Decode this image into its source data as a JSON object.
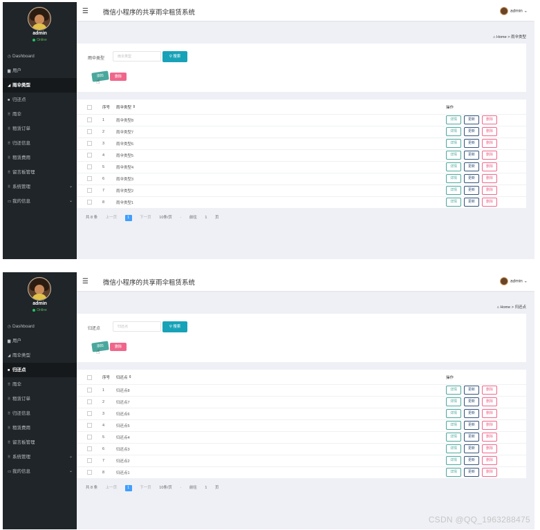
{
  "panels": [
    {
      "app_title": "微信小程序的共享雨伞租赁系统",
      "user": {
        "name": "admin",
        "status": "Online"
      },
      "menu": [
        {
          "label": "Dashboard",
          "icon": "clock-icon",
          "active": false
        },
        {
          "label": "用户",
          "icon": "folder-icon",
          "active": false
        },
        {
          "label": "雨伞类型",
          "icon": "arrow-icon",
          "active": true
        },
        {
          "label": "归还点",
          "icon": "square-icon",
          "active": false
        },
        {
          "label": "雨伞",
          "icon": "grid-icon",
          "active": false
        },
        {
          "label": "租赁订单",
          "icon": "grid-icon",
          "active": false
        },
        {
          "label": "归还信息",
          "icon": "grid-icon",
          "active": false
        },
        {
          "label": "租赁费用",
          "icon": "grid-icon",
          "active": false
        },
        {
          "label": "留言板管理",
          "icon": "grid-icon",
          "active": false
        },
        {
          "label": "系统管理",
          "icon": "grid-icon",
          "active": false,
          "has_chevron": true
        },
        {
          "label": "我的信息",
          "icon": "monitor-icon",
          "active": false,
          "has_chevron": true
        }
      ],
      "admin_label": "admin",
      "breadcrumb": {
        "home": "Home",
        "sep": ">",
        "current": "雨伞类型"
      },
      "search": {
        "label": "雨伞类型",
        "placeholder": "雨伞类型",
        "button": "搜索"
      },
      "actions": {
        "add": "添加",
        "delete": "删除"
      },
      "table": {
        "headers": {
          "index": "序号",
          "name": "雨伞类型",
          "sort": "⇕",
          "ops": "操作"
        },
        "rows": [
          {
            "index": "1",
            "name": "雨伞类型8"
          },
          {
            "index": "2",
            "name": "雨伞类型7"
          },
          {
            "index": "3",
            "name": "雨伞类型6"
          },
          {
            "index": "4",
            "name": "雨伞类型5"
          },
          {
            "index": "5",
            "name": "雨伞类型4"
          },
          {
            "index": "6",
            "name": "雨伞类型3"
          },
          {
            "index": "7",
            "name": "雨伞类型2"
          },
          {
            "index": "8",
            "name": "雨伞类型1"
          }
        ],
        "op_labels": {
          "detail": "详情",
          "edit": "更新",
          "remove": "删除"
        }
      },
      "pagination": {
        "total": "共 8 条",
        "prev": "上一页",
        "current": "1",
        "next": "下一页",
        "per_page": "10条/页",
        "dash": "-",
        "goto": "前往",
        "page_num": "1",
        "page_suffix": "页"
      }
    },
    {
      "app_title": "微信小程序的共享雨伞租赁系统",
      "user": {
        "name": "admin",
        "status": "Online"
      },
      "menu": [
        {
          "label": "Dashboard",
          "icon": "clock-icon",
          "active": false
        },
        {
          "label": "用户",
          "icon": "folder-icon",
          "active": false
        },
        {
          "label": "雨伞类型",
          "icon": "arrow-icon",
          "active": false
        },
        {
          "label": "归还点",
          "icon": "square-icon",
          "active": true
        },
        {
          "label": "雨伞",
          "icon": "grid-icon",
          "active": false
        },
        {
          "label": "租赁订单",
          "icon": "grid-icon",
          "active": false
        },
        {
          "label": "归还信息",
          "icon": "grid-icon",
          "active": false
        },
        {
          "label": "租赁费用",
          "icon": "grid-icon",
          "active": false
        },
        {
          "label": "留言板管理",
          "icon": "grid-icon",
          "active": false
        },
        {
          "label": "系统管理",
          "icon": "grid-icon",
          "active": false,
          "has_chevron": true
        },
        {
          "label": "我的信息",
          "icon": "monitor-icon",
          "active": false,
          "has_chevron": true
        }
      ],
      "admin_label": "admin",
      "breadcrumb": {
        "home": "Home",
        "sep": ">",
        "current": "归还点"
      },
      "search": {
        "label": "归还点",
        "placeholder": "归还点",
        "button": "搜索"
      },
      "actions": {
        "add": "添加",
        "delete": "删除"
      },
      "table": {
        "headers": {
          "index": "序号",
          "name": "归还点",
          "sort": "⇕",
          "ops": "操作"
        },
        "rows": [
          {
            "index": "1",
            "name": "归还点8"
          },
          {
            "index": "2",
            "name": "归还点7"
          },
          {
            "index": "3",
            "name": "归还点6"
          },
          {
            "index": "4",
            "name": "归还点5"
          },
          {
            "index": "5",
            "name": "归还点4"
          },
          {
            "index": "6",
            "name": "归还点3"
          },
          {
            "index": "7",
            "name": "归还点2"
          },
          {
            "index": "8",
            "name": "归还点1"
          }
        ],
        "op_labels": {
          "detail": "详情",
          "edit": "更新",
          "remove": "删除"
        }
      },
      "pagination": {
        "total": "共 8 条",
        "prev": "上一页",
        "current": "1",
        "next": "下一页",
        "per_page": "10条/页",
        "dash": "-",
        "goto": "前往",
        "page_num": "1",
        "page_suffix": "页"
      }
    }
  ],
  "icon_glyphs": {
    "clock-icon": "◷",
    "folder-icon": "▆",
    "arrow-icon": "◢",
    "square-icon": "■",
    "grid-icon": "⠿",
    "monitor-icon": "▭"
  },
  "watermark": "CSDN @QQ_1963288475"
}
